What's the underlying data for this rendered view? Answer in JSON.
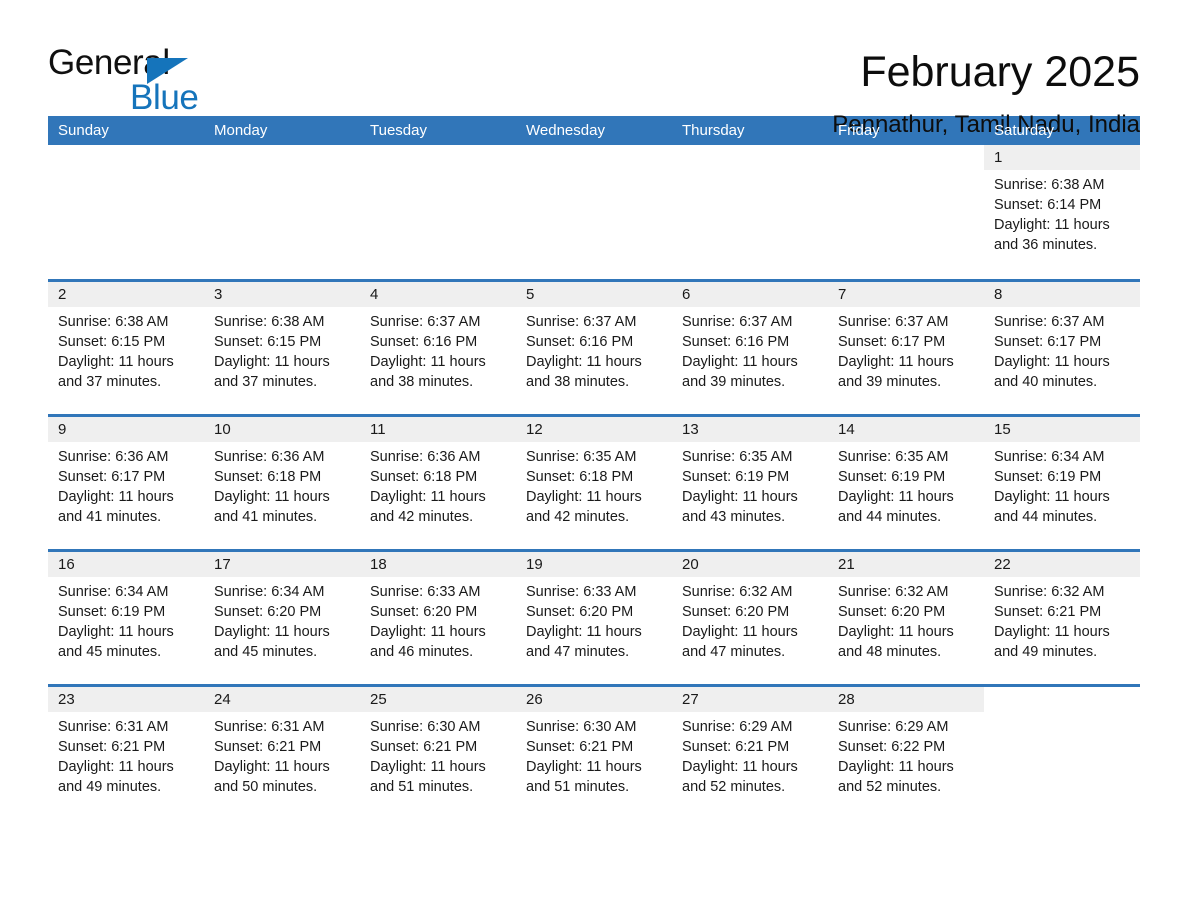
{
  "brand": {
    "name_part1": "General",
    "name_part2": "Blue",
    "accent_color": "#1574bb"
  },
  "header": {
    "title": "February 2025",
    "subtitle": "Pennathur, Tamil Nadu, India",
    "header_bg_color": "#3176b9"
  },
  "calendar": {
    "weekdays": [
      "Sunday",
      "Monday",
      "Tuesday",
      "Wednesday",
      "Thursday",
      "Friday",
      "Saturday"
    ],
    "weeks": [
      [
        {
          "day": "",
          "lines": []
        },
        {
          "day": "",
          "lines": []
        },
        {
          "day": "",
          "lines": []
        },
        {
          "day": "",
          "lines": []
        },
        {
          "day": "",
          "lines": []
        },
        {
          "day": "",
          "lines": []
        },
        {
          "day": "1",
          "lines": [
            "Sunrise: 6:38 AM",
            "Sunset: 6:14 PM",
            "Daylight: 11 hours and 36 minutes."
          ]
        }
      ],
      [
        {
          "day": "2",
          "lines": [
            "Sunrise: 6:38 AM",
            "Sunset: 6:15 PM",
            "Daylight: 11 hours and 37 minutes."
          ]
        },
        {
          "day": "3",
          "lines": [
            "Sunrise: 6:38 AM",
            "Sunset: 6:15 PM",
            "Daylight: 11 hours and 37 minutes."
          ]
        },
        {
          "day": "4",
          "lines": [
            "Sunrise: 6:37 AM",
            "Sunset: 6:16 PM",
            "Daylight: 11 hours and 38 minutes."
          ]
        },
        {
          "day": "5",
          "lines": [
            "Sunrise: 6:37 AM",
            "Sunset: 6:16 PM",
            "Daylight: 11 hours and 38 minutes."
          ]
        },
        {
          "day": "6",
          "lines": [
            "Sunrise: 6:37 AM",
            "Sunset: 6:16 PM",
            "Daylight: 11 hours and 39 minutes."
          ]
        },
        {
          "day": "7",
          "lines": [
            "Sunrise: 6:37 AM",
            "Sunset: 6:17 PM",
            "Daylight: 11 hours and 39 minutes."
          ]
        },
        {
          "day": "8",
          "lines": [
            "Sunrise: 6:37 AM",
            "Sunset: 6:17 PM",
            "Daylight: 11 hours and 40 minutes."
          ]
        }
      ],
      [
        {
          "day": "9",
          "lines": [
            "Sunrise: 6:36 AM",
            "Sunset: 6:17 PM",
            "Daylight: 11 hours and 41 minutes."
          ]
        },
        {
          "day": "10",
          "lines": [
            "Sunrise: 6:36 AM",
            "Sunset: 6:18 PM",
            "Daylight: 11 hours and 41 minutes."
          ]
        },
        {
          "day": "11",
          "lines": [
            "Sunrise: 6:36 AM",
            "Sunset: 6:18 PM",
            "Daylight: 11 hours and 42 minutes."
          ]
        },
        {
          "day": "12",
          "lines": [
            "Sunrise: 6:35 AM",
            "Sunset: 6:18 PM",
            "Daylight: 11 hours and 42 minutes."
          ]
        },
        {
          "day": "13",
          "lines": [
            "Sunrise: 6:35 AM",
            "Sunset: 6:19 PM",
            "Daylight: 11 hours and 43 minutes."
          ]
        },
        {
          "day": "14",
          "lines": [
            "Sunrise: 6:35 AM",
            "Sunset: 6:19 PM",
            "Daylight: 11 hours and 44 minutes."
          ]
        },
        {
          "day": "15",
          "lines": [
            "Sunrise: 6:34 AM",
            "Sunset: 6:19 PM",
            "Daylight: 11 hours and 44 minutes."
          ]
        }
      ],
      [
        {
          "day": "16",
          "lines": [
            "Sunrise: 6:34 AM",
            "Sunset: 6:19 PM",
            "Daylight: 11 hours and 45 minutes."
          ]
        },
        {
          "day": "17",
          "lines": [
            "Sunrise: 6:34 AM",
            "Sunset: 6:20 PM",
            "Daylight: 11 hours and 45 minutes."
          ]
        },
        {
          "day": "18",
          "lines": [
            "Sunrise: 6:33 AM",
            "Sunset: 6:20 PM",
            "Daylight: 11 hours and 46 minutes."
          ]
        },
        {
          "day": "19",
          "lines": [
            "Sunrise: 6:33 AM",
            "Sunset: 6:20 PM",
            "Daylight: 11 hours and 47 minutes."
          ]
        },
        {
          "day": "20",
          "lines": [
            "Sunrise: 6:32 AM",
            "Sunset: 6:20 PM",
            "Daylight: 11 hours and 47 minutes."
          ]
        },
        {
          "day": "21",
          "lines": [
            "Sunrise: 6:32 AM",
            "Sunset: 6:20 PM",
            "Daylight: 11 hours and 48 minutes."
          ]
        },
        {
          "day": "22",
          "lines": [
            "Sunrise: 6:32 AM",
            "Sunset: 6:21 PM",
            "Daylight: 11 hours and 49 minutes."
          ]
        }
      ],
      [
        {
          "day": "23",
          "lines": [
            "Sunrise: 6:31 AM",
            "Sunset: 6:21 PM",
            "Daylight: 11 hours and 49 minutes."
          ]
        },
        {
          "day": "24",
          "lines": [
            "Sunrise: 6:31 AM",
            "Sunset: 6:21 PM",
            "Daylight: 11 hours and 50 minutes."
          ]
        },
        {
          "day": "25",
          "lines": [
            "Sunrise: 6:30 AM",
            "Sunset: 6:21 PM",
            "Daylight: 11 hours and 51 minutes."
          ]
        },
        {
          "day": "26",
          "lines": [
            "Sunrise: 6:30 AM",
            "Sunset: 6:21 PM",
            "Daylight: 11 hours and 51 minutes."
          ]
        },
        {
          "day": "27",
          "lines": [
            "Sunrise: 6:29 AM",
            "Sunset: 6:21 PM",
            "Daylight: 11 hours and 52 minutes."
          ]
        },
        {
          "day": "28",
          "lines": [
            "Sunrise: 6:29 AM",
            "Sunset: 6:22 PM",
            "Daylight: 11 hours and 52 minutes."
          ]
        },
        {
          "day": "",
          "lines": []
        }
      ]
    ]
  }
}
